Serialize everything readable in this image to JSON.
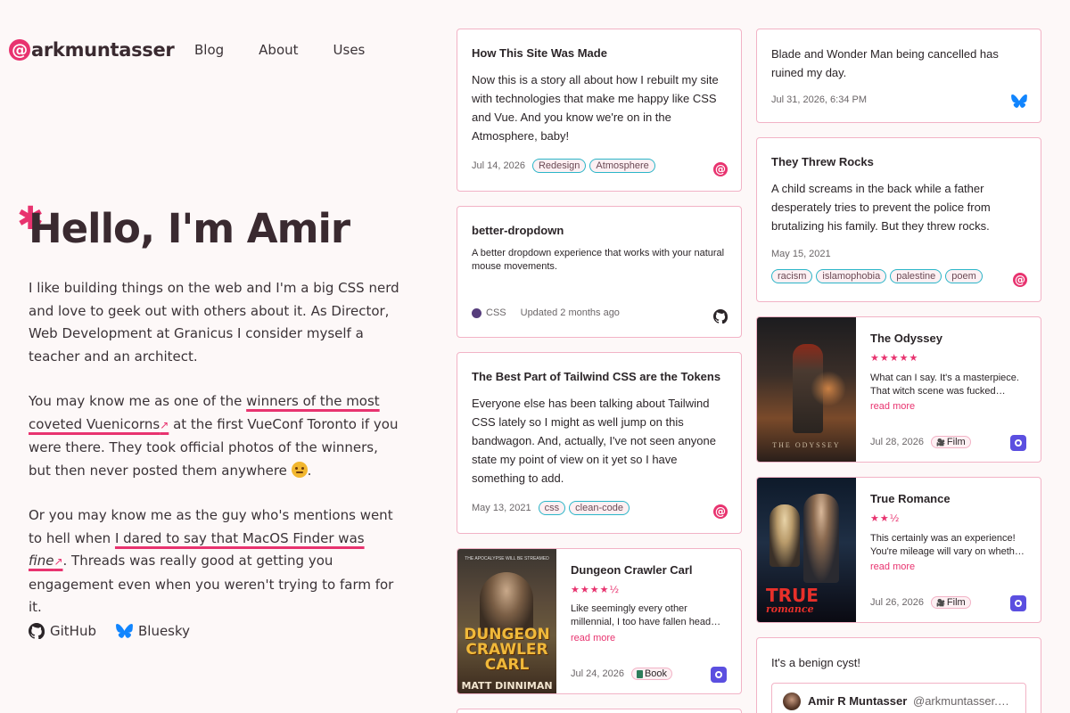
{
  "header": {
    "logo_at": "@",
    "logo_text": "arkmuntasser",
    "nav": [
      {
        "label": "Blog"
      },
      {
        "label": "About"
      },
      {
        "label": "Uses"
      }
    ]
  },
  "hero": {
    "title": "Hello, I'm Amir",
    "p1": "I like building things on the web and I'm a big CSS nerd and love to geek out with others about it. As Director, Web Development at Granicus I consider myself a teacher and an architect.",
    "p2_before": "You may know me as one of the ",
    "p2_link": "winners of the most coveted Vuenicorns",
    "p2_after": " at the first VueConf Toronto if you were there. They took official photos of the winners, but then never posted them anywhere ",
    "p2_end": ".",
    "p3_before": "Or you may know me as the guy who's mentions went to hell when ",
    "p3_link": "I dared to say that MacOS Finder was ",
    "p3_link_em": "fine",
    "p3_after": ". Threads was really good at getting you engagement even when you weren't trying to farm for it.",
    "arrow": "↗"
  },
  "social": [
    {
      "label": "GitHub",
      "icon": "github-icon"
    },
    {
      "label": "Bluesky",
      "icon": "bluesky-icon"
    }
  ],
  "cards": {
    "site": {
      "title": "How This Site Was Made",
      "body": "Now this is a story all about how I rebuilt my site with technologies that make me happy like CSS and Vue. And you know we're on in the Atmosphere, baby!",
      "date": "Jul 14, 2026",
      "tags": [
        "Redesign",
        "Atmosphere"
      ]
    },
    "dropdown": {
      "title": "better-dropdown",
      "body": "A better dropdown experience that works with your natural mouse movements.",
      "language": "CSS",
      "updated": "Updated 2 months ago"
    },
    "tailwind": {
      "title": "The Best Part of Tailwind CSS are the Tokens",
      "body": "Everyone else has been talking about Tailwind CSS lately so I might as well jump on this bandwagon. And, actually, I've not seen anyone state my point of view on it yet so I have something to add.",
      "date": "May 13, 2021",
      "tags": [
        "css",
        "clean-code"
      ]
    },
    "dcc": {
      "title": "Dungeon Crawler Carl",
      "stars": "★★★★½",
      "body": "Like seemingly every other millennial, I too have fallen head…",
      "readmore": "read more",
      "date": "Jul 24, 2026",
      "type": "Book",
      "poster_top": "THE APOCALYPSE WILL BE STREAMED",
      "poster_title": "DUNGEON CRAWLER CARL",
      "poster_author": "MATT DINNIMAN"
    },
    "blade": {
      "body": "Blade and Wonder Man being cancelled has ruined my day.",
      "date": "Jul 31, 2026, 6:34 PM"
    },
    "rocks": {
      "title": "They Threw Rocks",
      "body": "A child screams in the back while a father desperately tries to prevent the police from brutalizing his family. But they threw rocks.",
      "date": "May 15, 2021",
      "tags": [
        "racism",
        "islamophobia",
        "palestine",
        "poem"
      ]
    },
    "odyssey": {
      "title": "The Odyssey",
      "stars": "★★★★★",
      "body": "What can I say. It's a masterpiece. That witch scene was fucked…",
      "readmore": "read more",
      "date": "Jul 28, 2026",
      "type": "Film",
      "poster_text": "THE ODYSSEY"
    },
    "romance": {
      "title": "True Romance",
      "stars": "★★½",
      "body": "This certainly was an experience! You're mileage will vary on wheth…",
      "readmore": "read more",
      "date": "Jul 26, 2026",
      "type": "Film",
      "poster_text1": "TRUE",
      "poster_text2": "romance"
    },
    "cyst": {
      "body": "It's a benign cyst!",
      "quote_name": "Amir R Muntasser",
      "quote_handle": "@arkmuntasser.…"
    }
  },
  "colors": {
    "accent": "#e8336f",
    "card_border": "#f2b3c6",
    "tag_border": "#2bb5c8",
    "background": "#fdf8f8",
    "css_dot": "#563d7c",
    "letterboxd": "#5b4fe0",
    "bluesky": "#1185fe"
  }
}
